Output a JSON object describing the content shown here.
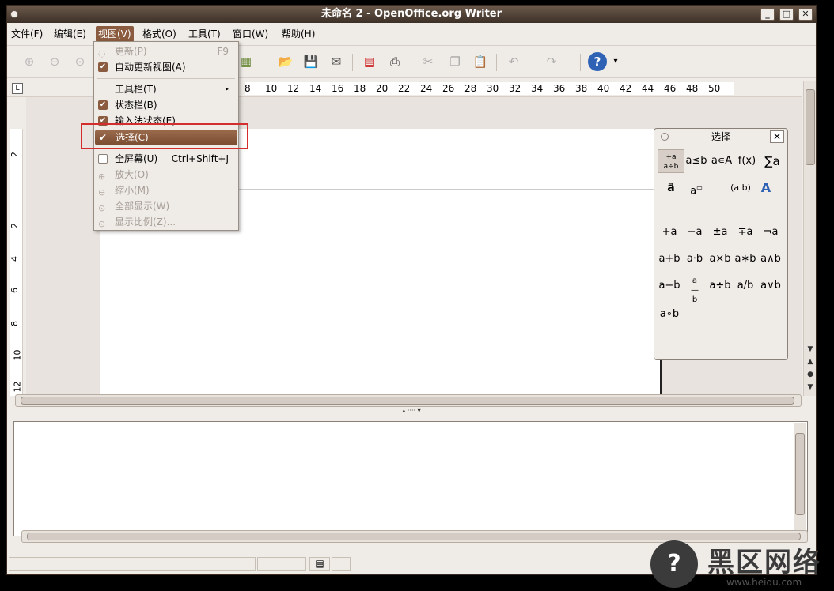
{
  "window": {
    "title": "未命名 2 - OpenOffice.org Writer",
    "controls": [
      "_",
      "□",
      "✕"
    ]
  },
  "menubar": [
    "文件(F)",
    "编辑(E)",
    "视图(V)",
    "格式(O)",
    "工具(T)",
    "窗口(W)",
    "帮助(H)"
  ],
  "ruler": {
    "h_numbers": [
      "8",
      "10",
      "12",
      "14",
      "16",
      "18",
      "20",
      "22",
      "24",
      "26",
      "28",
      "30",
      "32",
      "34",
      "36",
      "38",
      "40",
      "42",
      "44",
      "46",
      "48",
      "50"
    ],
    "v_numbers": [
      "2",
      "2",
      "4",
      "6",
      "8",
      "10",
      "12"
    ]
  },
  "view_menu": {
    "items": [
      {
        "label": "更新(P)",
        "accel": "F9",
        "state": "disabled"
      },
      {
        "label": "自动更新视图(A)",
        "state": "checked"
      },
      {
        "label": "工具栏(T)",
        "state": "submenu"
      },
      {
        "label": "状态栏(B)",
        "state": "checked"
      },
      {
        "label": "输入法状态(E)",
        "state": "checked"
      },
      {
        "label": "选择(C)",
        "state": "checked-selected"
      },
      {
        "label": "全屏幕(U)",
        "accel": "Ctrl+Shift+J",
        "state": "unchecked"
      },
      {
        "label": "放大(O)",
        "state": "disabled"
      },
      {
        "label": "缩小(M)",
        "state": "disabled"
      },
      {
        "label": "全部显示(W)",
        "state": "disabled"
      },
      {
        "label": "显示比例(Z)...",
        "state": "disabled"
      }
    ]
  },
  "palette": {
    "title": "选择",
    "close": "✕",
    "categories": [
      "+a/a÷b",
      "a≤b",
      "a∊A",
      "f(x)",
      "∑a",
      "a⃗",
      "a",
      "(a b)",
      "A"
    ],
    "operators": [
      "+a",
      "−a",
      "±a",
      "∓a",
      "¬a",
      "a+b",
      "a⋅b",
      "a×b",
      "a∗b",
      "a∧b",
      "a−b",
      "a/b frac",
      "a÷b",
      "a/b",
      "a∨b",
      "a∘b"
    ]
  },
  "watermark": {
    "text": "黑区网络",
    "url": "www.heiqu.com"
  }
}
